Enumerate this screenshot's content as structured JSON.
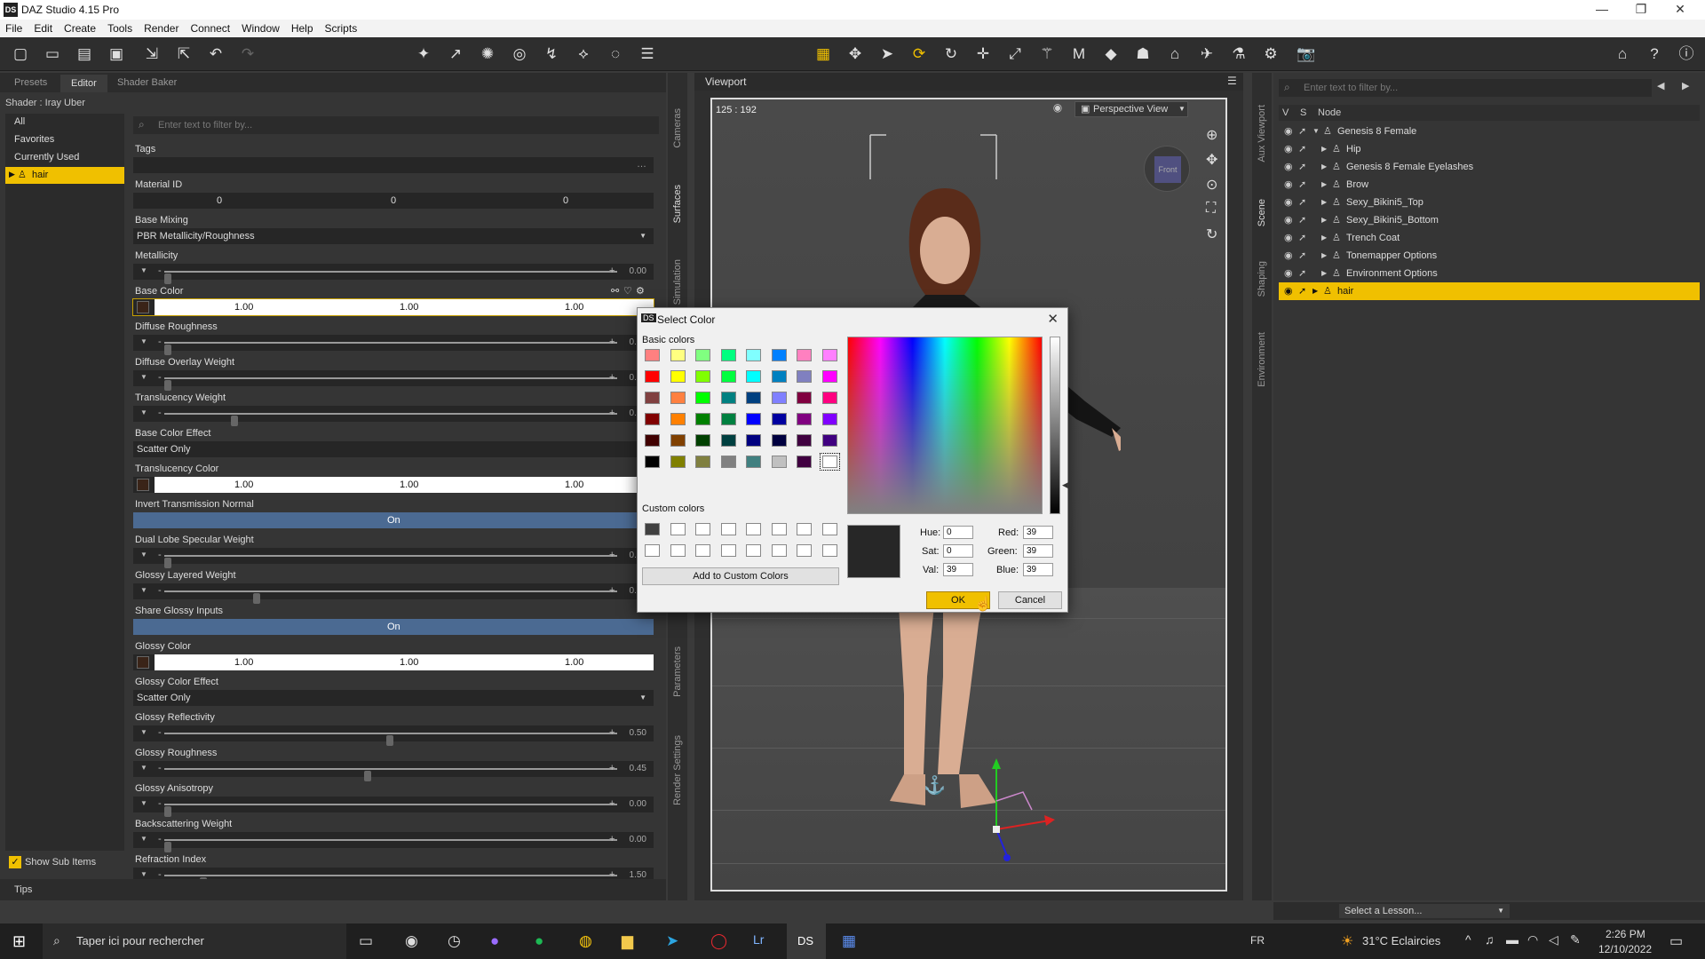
{
  "window": {
    "title": "DAZ Studio 4.15 Pro",
    "logo": "DS",
    "min": "—",
    "max": "❐",
    "close": "✕"
  },
  "menu": [
    "File",
    "Edit",
    "Create",
    "Tools",
    "Render",
    "Connect",
    "Window",
    "Help",
    "Scripts"
  ],
  "left": {
    "tabs": [
      "Presets",
      "Editor",
      "Shader Baker"
    ],
    "shader": "Shader : Iray Uber",
    "categories": [
      "All",
      "Favorites",
      "Currently Used",
      "hair"
    ],
    "filter_placeholder": "Enter text to filter by...",
    "show_sub": "Show Sub Items",
    "tips": "Tips",
    "props": [
      {
        "label": "Tags",
        "kind": "blank"
      },
      {
        "label": "Material ID",
        "kind": "triple-dark",
        "vals": [
          "0",
          "0",
          "0"
        ]
      },
      {
        "label": "Base Mixing",
        "kind": "dropdown",
        "value": "PBR Metallicity/Roughness"
      },
      {
        "label": "Metallicity",
        "kind": "slider",
        "value": "0.00",
        "pos": 0
      },
      {
        "label": "Base Color",
        "kind": "color",
        "vals": [
          "1.00",
          "1.00",
          "1.00"
        ]
      },
      {
        "label": "Diffuse Roughness",
        "kind": "slider",
        "value": "0.00",
        "pos": 0
      },
      {
        "label": "Diffuse Overlay Weight",
        "kind": "slider",
        "value": "0.00",
        "pos": 0
      },
      {
        "label": "Translucency Weight",
        "kind": "slider",
        "value": "0.15",
        "pos": 0.15
      },
      {
        "label": "Base Color Effect",
        "kind": "dropdown",
        "value": "Scatter Only"
      },
      {
        "label": "Translucency Color",
        "kind": "color",
        "vals": [
          "1.00",
          "1.00",
          "1.00"
        ]
      },
      {
        "label": "Invert Transmission Normal",
        "kind": "on",
        "value": "On"
      },
      {
        "label": "Dual Lobe Specular Weight",
        "kind": "slider",
        "value": "0.00",
        "pos": 0
      },
      {
        "label": "Glossy Layered Weight",
        "kind": "slider",
        "value": "0.20",
        "pos": 0.2
      },
      {
        "label": "Share Glossy Inputs",
        "kind": "on",
        "value": "On"
      },
      {
        "label": "Glossy Color",
        "kind": "color",
        "vals": [
          "1.00",
          "1.00",
          "1.00"
        ]
      },
      {
        "label": "Glossy Color Effect",
        "kind": "dropdown",
        "value": "Scatter Only"
      },
      {
        "label": "Glossy Reflectivity",
        "kind": "slider",
        "value": "0.50",
        "pos": 0.5
      },
      {
        "label": "Glossy Roughness",
        "kind": "slider",
        "value": "0.45",
        "pos": 0.45
      },
      {
        "label": "Glossy Anisotropy",
        "kind": "slider",
        "value": "0.00",
        "pos": 0
      },
      {
        "label": "Backscattering Weight",
        "kind": "slider",
        "value": "0.00",
        "pos": 0
      },
      {
        "label": "Refraction Index",
        "kind": "slider",
        "value": "1.50",
        "pos": 0.08
      }
    ]
  },
  "side_tabs_left": [
    "Cameras",
    "Surfaces",
    "Simulation",
    "Parameters",
    "Render Settings"
  ],
  "side_tabs_right": [
    "Aux Viewport",
    "Scene",
    "Shaping",
    "Environment"
  ],
  "viewport": {
    "tab": "Viewport",
    "coords": "125 : 192",
    "view": "Perspective View",
    "cube": "Front"
  },
  "scene": {
    "filter_placeholder": "Enter text to filter by...",
    "cols": [
      "V",
      "S",
      "Node"
    ],
    "nodes": [
      {
        "name": "Genesis 8 Female",
        "indent": 0,
        "expanded": true
      },
      {
        "name": "Hip",
        "indent": 1
      },
      {
        "name": "Genesis 8 Female Eyelashes",
        "indent": 1
      },
      {
        "name": "Brow",
        "indent": 1
      },
      {
        "name": "Sexy_Bikini5_Top",
        "indent": 1
      },
      {
        "name": "Sexy_Bikini5_Bottom",
        "indent": 1
      },
      {
        "name": "Trench Coat",
        "indent": 1
      },
      {
        "name": "Tonemapper Options",
        "indent": 1
      },
      {
        "name": "Environment Options",
        "indent": 1
      },
      {
        "name": "hair",
        "indent": 0,
        "selected": true
      }
    ],
    "lesson": "Select a Lesson..."
  },
  "dialog": {
    "title": "Select Color",
    "basic_label": "Basic colors",
    "custom_label": "Custom colors",
    "basic": [
      [
        "#ff8080",
        "#ffff80",
        "#80ff80",
        "#00ff80",
        "#80ffff",
        "#0080ff",
        "#ff80c0",
        "#ff80ff"
      ],
      [
        "#ff0000",
        "#ffff00",
        "#80ff00",
        "#00ff40",
        "#00ffff",
        "#0080c0",
        "#8080c0",
        "#ff00ff"
      ],
      [
        "#804040",
        "#ff8040",
        "#00ff00",
        "#008080",
        "#004080",
        "#8080ff",
        "#800040",
        "#ff0080"
      ],
      [
        "#800000",
        "#ff8000",
        "#008000",
        "#008040",
        "#0000ff",
        "#0000a0",
        "#800080",
        "#8000ff"
      ],
      [
        "#400000",
        "#804000",
        "#004000",
        "#004040",
        "#000080",
        "#000040",
        "#400040",
        "#400080"
      ],
      [
        "#000000",
        "#808000",
        "#808040",
        "#808080",
        "#408080",
        "#c0c0c0",
        "#400040",
        "#ffffff"
      ]
    ],
    "custom": [
      [
        "#404040",
        "#ffffff",
        "#ffffff",
        "#ffffff",
        "#ffffff",
        "#ffffff",
        "#ffffff",
        "#ffffff"
      ],
      [
        "#ffffff",
        "#ffffff",
        "#ffffff",
        "#ffffff",
        "#ffffff",
        "#ffffff",
        "#ffffff",
        "#ffffff"
      ]
    ],
    "add_custom": "Add to Custom Colors",
    "fields": {
      "hue_l": "Hue:",
      "hue": "0",
      "sat_l": "Sat:",
      "sat": "0",
      "val_l": "Val:",
      "val": "39",
      "red_l": "Red:",
      "red": "39",
      "green_l": "Green:",
      "green": "39",
      "blue_l": "Blue:",
      "blue": "39"
    },
    "ok": "OK",
    "cancel": "Cancel"
  },
  "taskbar": {
    "search": "Taper ici pour rechercher",
    "lang": "FR",
    "weather": "31°C  Eclaircies",
    "time": "2:26 PM",
    "date": "12/10/2022"
  }
}
